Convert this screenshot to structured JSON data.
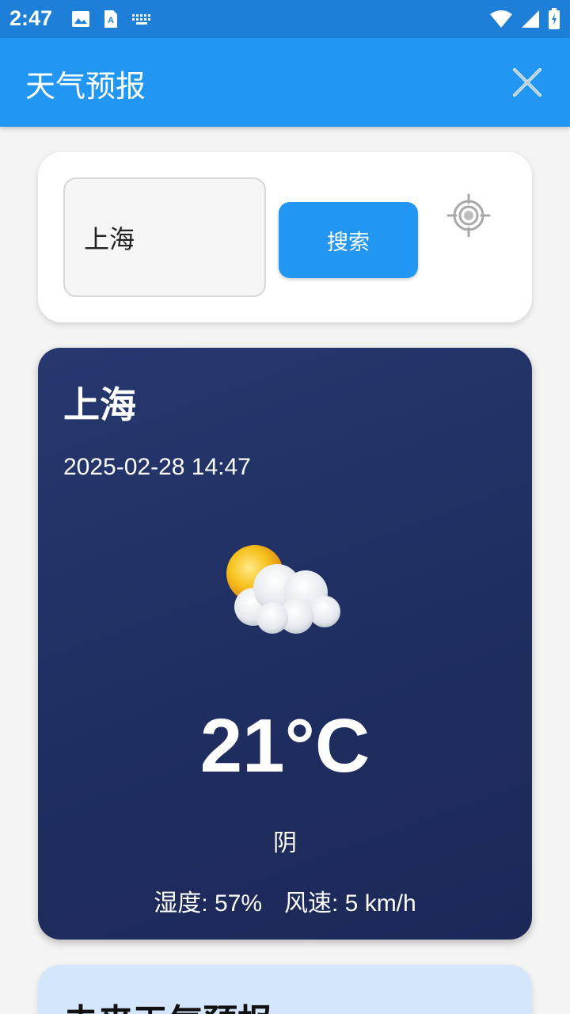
{
  "status_bar": {
    "time": "2:47",
    "icons_left": [
      "image-icon",
      "text-a-icon",
      "keyboard-icon"
    ],
    "icons_right": [
      "wifi-icon",
      "signal-icon",
      "battery-icon"
    ]
  },
  "app_bar": {
    "title": "天气预报",
    "close_icon": "close-icon"
  },
  "search": {
    "input_value": "上海",
    "button_label": "搜索",
    "locate_icon": "locate-icon"
  },
  "weather": {
    "city": "上海",
    "datetime": "2025-02-28 14:47",
    "icon": "partly-cloudy-icon",
    "temperature": "21°C",
    "condition": "阴",
    "humidity": "湿度: 57%",
    "wind": "风速: 5 km/h"
  },
  "forecast": {
    "title": "未来天气预报"
  },
  "colors": {
    "status_bar": "#1d7fd8",
    "primary": "#2196f3",
    "card_dark": "#1f2e60",
    "forecast_bg": "#d4e6fb"
  }
}
